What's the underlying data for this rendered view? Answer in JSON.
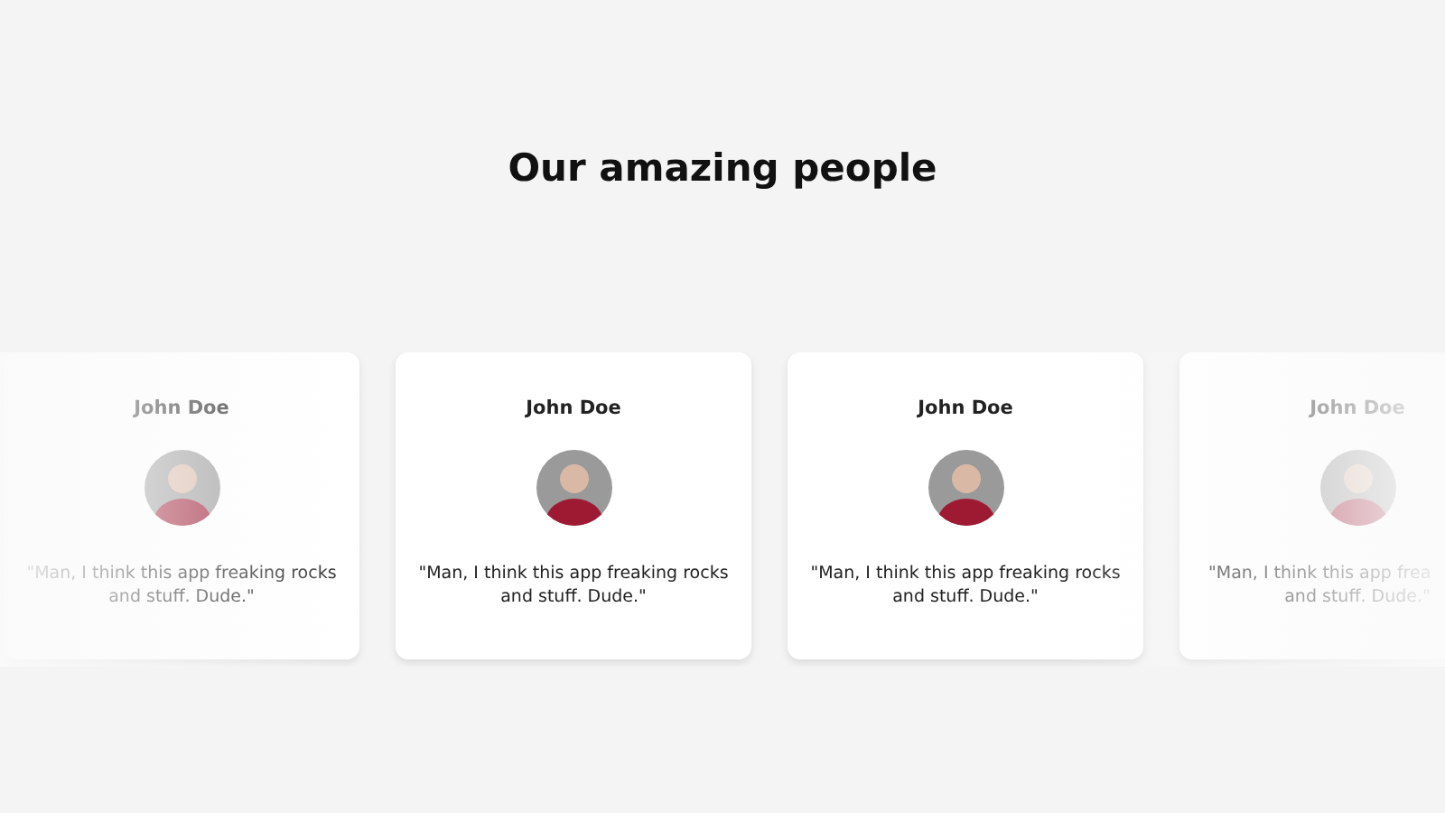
{
  "title": "Our amazing people",
  "cards": [
    {
      "name": "John Doe",
      "quote_lines": [
        "\"Man, I think this app freaking rocks",
        "and stuff. Dude.\""
      ],
      "cut": false
    },
    {
      "name": "John Doe",
      "quote_lines": [
        "\"Man, I think this app freaking rocks",
        "and stuff. Dude.\""
      ],
      "cut": false
    },
    {
      "name": "John Doe",
      "quote_lines": [
        "\"Man, I think this app freaking rocks",
        "and stuff. Dude.\""
      ],
      "cut": false
    },
    {
      "name": "John Doe",
      "quote_lines": [
        "\"Man, I think this app frea",
        "and stuff. Dude.\""
      ],
      "cut": true
    }
  ]
}
